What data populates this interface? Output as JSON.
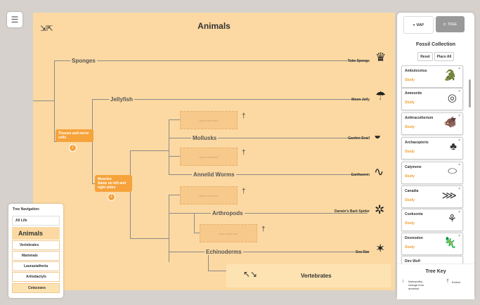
{
  "canvas_title": "Animals",
  "vertebrates_title": "Vertebrates",
  "clades": {
    "sponges": "Sponges",
    "jellyfish": "Jellyfish",
    "mollusks": "Mollusks",
    "annelid": "Annelid Worms",
    "arthropods": "Arthropods",
    "echinoderms": "Echinoderms"
  },
  "leaves": {
    "tube_sponge": "Tube Sponge",
    "moon_jelly": "Moon Jelly",
    "garden_snail": "Garden Snail",
    "earthworm": "Earthworm",
    "spider": "Darwin's Bark Spider",
    "sea_star": "Sea Star"
  },
  "nodes": {
    "tissues": "Tissues and nerve cells",
    "muscles": "Muscles",
    "symmetry": "Same on left and right sides",
    "info_glyph": "i"
  },
  "drop_label": "drop fossil here",
  "extinct_glyph": "†",
  "sidebar": {
    "tab_map": "MAP",
    "tab_tree": "TREE",
    "heading": "Fossil Collection",
    "reset": "Reset",
    "place_all": "Place All",
    "study": "Study",
    "close": "×",
    "fossils": [
      "Ambulocetus",
      "Ammonite",
      "Anthracotherium",
      "Archaeopteris",
      "Calymene",
      "Canadia",
      "Cooksonia",
      "Desmodon",
      "Dire Wolf"
    ],
    "tree_key": "Tree Key",
    "key_info": "Noteworthy change from ancestor",
    "key_extinct": "Extinct"
  },
  "nav": {
    "heading": "Tree Navigation:",
    "all": "All Life",
    "animals": "Animals",
    "items": [
      "Vertebrates",
      "Mammals",
      "Laurasiatheria",
      "Artiodactyls",
      "Cetaceans"
    ]
  },
  "icons": {
    "menu": "menu-icon",
    "collapse": "collapse-arrows-icon",
    "expand": "expand-arrows-icon",
    "map": "map-icon",
    "tree": "tree-icon"
  },
  "colors": {
    "canvas": "#fcd9a2",
    "node": "#f6a33b",
    "study": "#f0a030"
  }
}
